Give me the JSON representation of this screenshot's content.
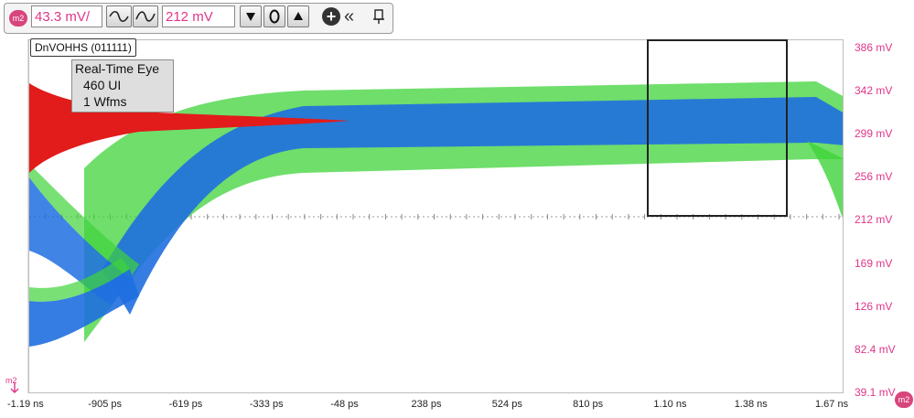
{
  "toolbar": {
    "channel_badge": "m2",
    "scale_value": "43.3 mV/",
    "offset_value": "212 mV",
    "buttons": [
      "wave-smooth-icon",
      "wave-icon",
      "arrow-down-icon",
      "zero-icon",
      "arrow-up-icon",
      "add-icon",
      "collapse-left-icon",
      "pin-icon"
    ]
  },
  "plot": {
    "waveform_label": "DnVOHHS (011111)",
    "info": {
      "title": "Real-Time Eye",
      "ui": "460 UI",
      "wfms": "1 Wfms"
    },
    "y_ticks": [
      "386 mV",
      "342 mV",
      "299 mV",
      "256 mV",
      "212 mV",
      "169 mV",
      "126 mV",
      "82.4 mV",
      "39.1 mV"
    ],
    "x_ticks": [
      "-1.19 ns",
      "-905 ps",
      "-619 ps",
      "-333 ps",
      "-48 ps",
      "238 ps",
      "524 ps",
      "810 ps",
      "1.10 ns",
      "1.38 ns",
      "1.67 ns"
    ],
    "ref_marker": "m2",
    "corner_badge": "m2",
    "colors": {
      "accent": "#e0358a",
      "histogram": "#e21b1b",
      "eye_core": "#1f6fe0",
      "eye_edge": "#22c21a"
    }
  }
}
